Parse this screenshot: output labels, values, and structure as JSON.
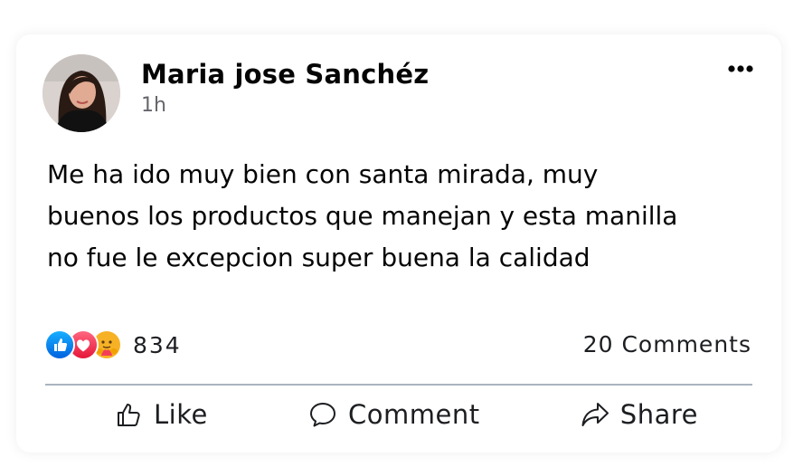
{
  "post": {
    "author": "Maria jose Sanchéz",
    "timestamp": "1h",
    "text": "Me ha ido muy bien con santa mirada, muy\nbuenos los productos que manejan y esta manilla\nno fue le excepcion super buena la calidad",
    "reactions": {
      "icons": [
        "like-icon",
        "love-icon",
        "care-icon"
      ],
      "count": "834"
    },
    "comments_count": "20 Comments"
  },
  "actions": {
    "like_label": "Like",
    "comment_label": "Comment",
    "share_label": "Share"
  },
  "colors": {
    "like_blue": "#1877f2",
    "love_red": "#f33e58",
    "care_yellow": "#f7b125",
    "divider": "#aab4c0"
  }
}
